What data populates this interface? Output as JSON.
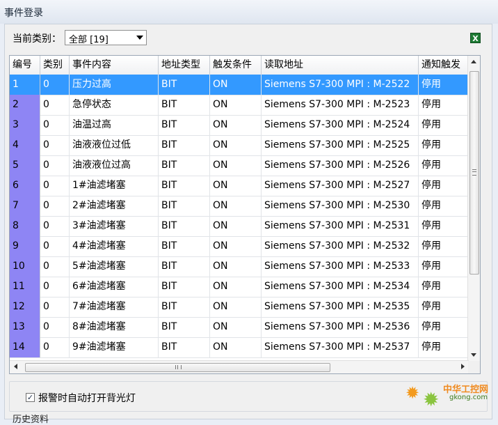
{
  "window": {
    "title": "事件登录"
  },
  "category": {
    "label": "当前类别：",
    "value": "全部 [19]"
  },
  "export": {
    "icon": "excel-icon",
    "glyph": "X"
  },
  "table": {
    "columns": [
      "编号",
      "类别",
      "事件内容",
      "地址类型",
      "触发条件",
      "读取地址",
      "通知触发"
    ],
    "rows": [
      [
        "1",
        "0",
        "压力过高",
        "BIT",
        "ON",
        "Siemens S7-300 MPI : M-2522",
        "停用"
      ],
      [
        "2",
        "0",
        "急停状态",
        "BIT",
        "ON",
        "Siemens S7-300 MPI : M-2523",
        "停用"
      ],
      [
        "3",
        "0",
        "油温过高",
        "BIT",
        "ON",
        "Siemens S7-300 MPI : M-2524",
        "停用"
      ],
      [
        "4",
        "0",
        "油液液位过低",
        "BIT",
        "ON",
        "Siemens S7-300 MPI : M-2525",
        "停用"
      ],
      [
        "5",
        "0",
        "油液液位过高",
        "BIT",
        "ON",
        "Siemens S7-300 MPI : M-2526",
        "停用"
      ],
      [
        "6",
        "0",
        "1#油滤堵塞",
        "BIT",
        "ON",
        "Siemens S7-300 MPI : M-2527",
        "停用"
      ],
      [
        "7",
        "0",
        "2#油滤堵塞",
        "BIT",
        "ON",
        "Siemens S7-300 MPI : M-2530",
        "停用"
      ],
      [
        "8",
        "0",
        "3#油滤堵塞",
        "BIT",
        "ON",
        "Siemens S7-300 MPI : M-2531",
        "停用"
      ],
      [
        "9",
        "0",
        "4#油滤堵塞",
        "BIT",
        "ON",
        "Siemens S7-300 MPI : M-2532",
        "停用"
      ],
      [
        "10",
        "0",
        "5#油滤堵塞",
        "BIT",
        "ON",
        "Siemens S7-300 MPI : M-2533",
        "停用"
      ],
      [
        "11",
        "0",
        "6#油滤堵塞",
        "BIT",
        "ON",
        "Siemens S7-300 MPI : M-2534",
        "停用"
      ],
      [
        "12",
        "0",
        "7#油滤堵塞",
        "BIT",
        "ON",
        "Siemens S7-300 MPI : M-2535",
        "停用"
      ],
      [
        "13",
        "0",
        "8#油滤堵塞",
        "BIT",
        "ON",
        "Siemens S7-300 MPI : M-2536",
        "停用"
      ],
      [
        "14",
        "0",
        "9#油滤堵塞",
        "BIT",
        "ON",
        "Siemens S7-300 MPI : M-2537",
        "停用"
      ]
    ],
    "selected_row": 0
  },
  "options": {
    "backlight_label": "报警时自动打开背光灯",
    "backlight_checked": true,
    "check_glyph": "✓"
  },
  "next_section": {
    "label": "历史资料"
  },
  "watermark": {
    "name": "中华工控网",
    "url": "gkong.com",
    "gear_glyph": "✹"
  },
  "colors": {
    "selection": "#3399ff",
    "number_column": "#8e85f4",
    "panel": "#f0f0f0"
  }
}
